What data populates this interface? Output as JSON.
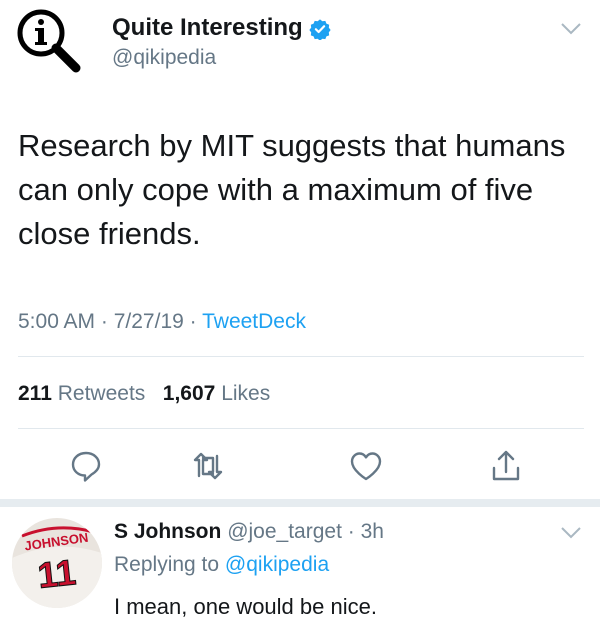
{
  "tweet": {
    "display_name": "Quite Interesting",
    "handle": "@qikipedia",
    "text": "Research by MIT suggests that humans can only cope with a maximum of five close friends.",
    "time": "5:00 AM",
    "date": "7/27/19",
    "source": "TweetDeck",
    "retweets_count": "211",
    "retweets_label": "Retweets",
    "likes_count": "1,607",
    "likes_label": "Likes"
  },
  "reply": {
    "display_name": "S Johnson",
    "handle": "@joe_target",
    "time": "3h",
    "replying_prefix": "Replying to",
    "replying_to": "@qikipedia",
    "text": "I mean, one would be nice.",
    "jersey_name": "JOHNSON",
    "jersey_number": "11"
  },
  "colors": {
    "accent": "#1da1f2",
    "secondary_text": "#657786",
    "jersey_red": "#c8102e"
  }
}
